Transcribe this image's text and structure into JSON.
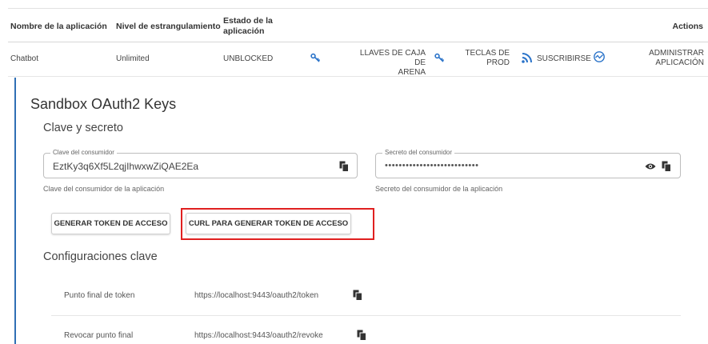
{
  "table": {
    "headers": {
      "app_name": "Nombre de la aplicación",
      "throttle": "Nivel de estrangulamiento",
      "status_line1": "Estado de la",
      "status_line2": "aplicación",
      "actions": "Actions"
    },
    "row": {
      "app_name": "Chatbot",
      "throttle": "Unlimited",
      "status": "UNBLOCKED",
      "sandbox_keys_line1": "LLAVES DE CAJA DE",
      "sandbox_keys_line2": "ARENA",
      "prod_keys_line1": "TECLAS DE",
      "prod_keys_line2": "PROD",
      "subscribe": "SUSCRIBIRSE",
      "manage_line1": "ADMINISTRAR",
      "manage_line2": "APLICACIÓN"
    }
  },
  "panel": {
    "title": "Sandbox OAuth2 Keys",
    "key_secret_title": "Clave y secreto",
    "consumer_key": {
      "legend": "Clave del consumidor",
      "value": "EztKy3q6Xf5L2qjIhwxwZiQAE2Ea",
      "helper": "Clave del consumidor de la aplicación"
    },
    "consumer_secret": {
      "legend": "Secreto del consumidor",
      "value": "•••••••••••••••••••••••••••",
      "helper": "Secreto del consumidor de la aplicación"
    },
    "buttons": {
      "generate": "GENERAR TOKEN DE ACCESO",
      "curl": "CURL PARA GENERAR TOKEN DE ACCESO"
    },
    "config_title": "Configuraciones clave",
    "endpoints": [
      {
        "label": "Punto final de token",
        "url": "https://localhost:9443/oauth2/token"
      },
      {
        "label": "Revocar punto final",
        "url": "https://localhost:9443/oauth2/revoke"
      }
    ]
  },
  "colors": {
    "accent": "#2f6fb5",
    "icon_blue": "#2a73c9",
    "highlight_red": "#e02020"
  },
  "icons": [
    "key-icon",
    "key-icon",
    "subscribe-feed-icon",
    "manage-app-icon",
    "copy-icon",
    "eye-icon"
  ]
}
